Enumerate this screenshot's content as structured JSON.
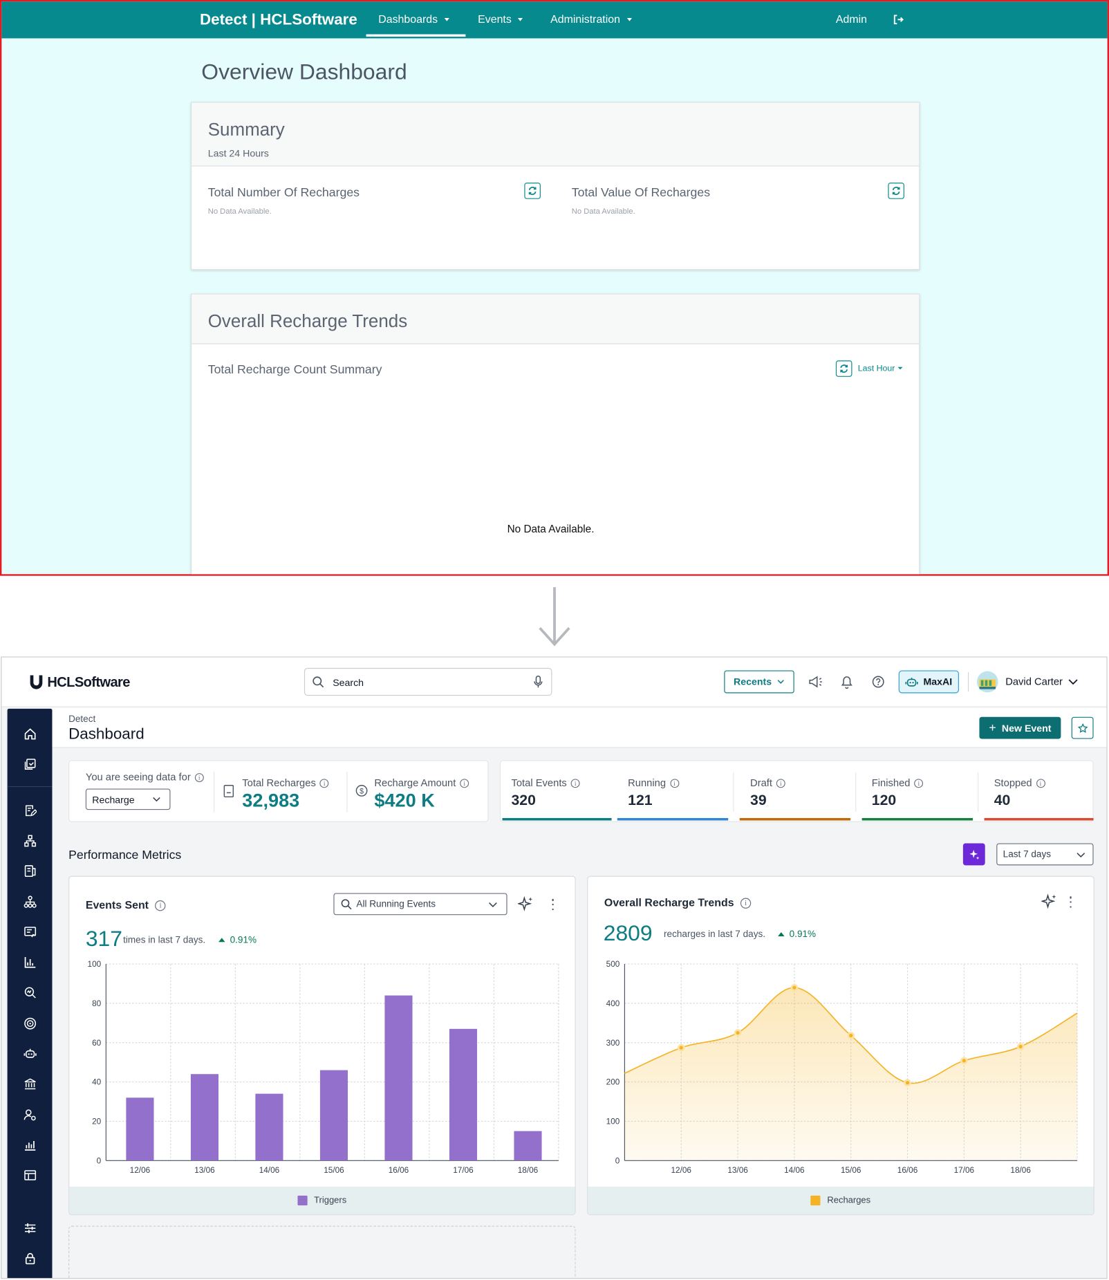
{
  "old_ui": {
    "nav": {
      "brand": "Detect | HCLSoftware",
      "items": [
        "Dashboards",
        "Events",
        "Administration"
      ],
      "active_item": "Dashboards",
      "user": "Admin",
      "logout_icon": "logout-icon"
    },
    "page_title": "Overview Dashboard",
    "summary": {
      "title": "Summary",
      "subtitle": "Last 24 Hours",
      "widgets": [
        {
          "label": "Total Number Of Recharges",
          "status": "No Data Available."
        },
        {
          "label": "Total Value Of Recharges",
          "status": "No Data Available."
        }
      ]
    },
    "trends": {
      "title": "Overall Recharge Trends",
      "widget_label": "Total Recharge Count Summary",
      "range": "Last Hour",
      "empty": "No Data Available."
    }
  },
  "new_ui": {
    "header": {
      "logo": "HCLSoftware",
      "search_placeholder": "Search",
      "recents": "Recents",
      "maxai": "MaxAI",
      "user_name": "David Carter"
    },
    "sidebar_icons": [
      "home-icon",
      "catalog-icon",
      "edit-document-icon",
      "hierarchy-icon",
      "device-icon",
      "org-chart-icon",
      "form-icon",
      "bar-chart-icon",
      "analytics-search-icon",
      "target-icon",
      "robot-icon",
      "bank-icon",
      "user-settings-icon",
      "stats-icon",
      "table-icon",
      "sliders-icon",
      "lock-icon"
    ],
    "page": {
      "breadcrumb": "Detect",
      "title": "Dashboard",
      "new_event": "New Event"
    },
    "data_for": {
      "label": "You are seeing data for",
      "selected": "Recharge"
    },
    "totals": {
      "recharges_label": "Total Recharges",
      "recharges_value": "32,983",
      "amount_label": "Recharge Amount",
      "amount_value": "$420 K"
    },
    "event_stats": [
      {
        "label": "Total Events",
        "value": "320",
        "color": "#0d7d83"
      },
      {
        "label": "Running",
        "value": "121",
        "color": "#2f86d6"
      },
      {
        "label": "Draft",
        "value": "39",
        "color": "#c26a0a"
      },
      {
        "label": "Finished",
        "value": "120",
        "color": "#15803d"
      },
      {
        "label": "Stopped",
        "value": "40",
        "color": "#dc4a2e"
      }
    ],
    "metrics": {
      "title": "Performance Metrics",
      "range": "Last 7 days"
    },
    "events_sent": {
      "title": "Events Sent",
      "filter": "All Running Events",
      "kpi": "317",
      "kpi_text": "times in last 7 days.",
      "pct": "0.91%",
      "legend": "Triggers"
    },
    "recharge_trends": {
      "title": "Overall Recharge Trends",
      "kpi": "2809",
      "kpi_text": "recharges in last 7 days.",
      "pct": "0.91%",
      "legend": "Recharges"
    }
  },
  "chart_data": [
    {
      "type": "bar",
      "title": "Events Sent",
      "categories": [
        "12/06",
        "13/06",
        "14/06",
        "15/06",
        "16/06",
        "17/06",
        "18/06"
      ],
      "series": [
        {
          "name": "Triggers",
          "values": [
            32,
            44,
            34,
            46,
            84,
            67,
            15
          ],
          "color": "#9370cc"
        }
      ],
      "ylim": [
        0,
        100
      ],
      "yticks": [
        0,
        20,
        40,
        60,
        80,
        100
      ],
      "grid": true,
      "legend": "bottom"
    },
    {
      "type": "area",
      "title": "Overall Recharge Trends",
      "categories": [
        "12/06",
        "13/06",
        "14/06",
        "15/06",
        "16/06",
        "17/06",
        "18/06"
      ],
      "series": [
        {
          "name": "Recharges",
          "values": [
            287,
            325,
            440,
            318,
            198,
            254,
            290
          ],
          "color": "#f5b323"
        }
      ],
      "ylim": [
        0,
        500
      ],
      "yticks": [
        0,
        100,
        200,
        300,
        400,
        500
      ],
      "grid": true,
      "legend": "bottom"
    }
  ]
}
